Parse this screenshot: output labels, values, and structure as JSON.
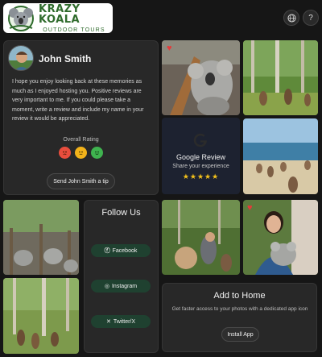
{
  "header": {
    "logo_title": "KRAZY KOALA",
    "logo_subtitle": "OUTDOOR TOURS",
    "language_icon": "globe-icon",
    "help_label": "?"
  },
  "profile": {
    "name": "John Smith",
    "message": "I hope you enjoy looking back at these memories as much as I enjoyed hosting you. Positive reviews are very important to me. If you could please take a moment, write a review and include my name in your review it would be appreciated.",
    "rating_label": "Overall Rating",
    "faces": [
      "frown-face-icon",
      "neutral-face-icon",
      "smile-face-icon"
    ],
    "tip_button": "Send John Smith a tip"
  },
  "google_review": {
    "title": "Google Review",
    "subtitle": "Share your experience",
    "stars": "★★★★★"
  },
  "follow": {
    "title": "Follow Us",
    "facebook": "Facebook",
    "instagram": "Instagram",
    "twitter": "Twitter/X"
  },
  "add_to_home": {
    "title": "Add to Home",
    "description": "Get faster access to your photos with a dedicated app icon",
    "button": "Install App"
  },
  "colors": {
    "background": "#161616",
    "card": "#282828",
    "brand_green": "#2f6b2c",
    "social_button": "#1f4130",
    "star": "#f3c11b",
    "heart": "#e53a3a"
  }
}
